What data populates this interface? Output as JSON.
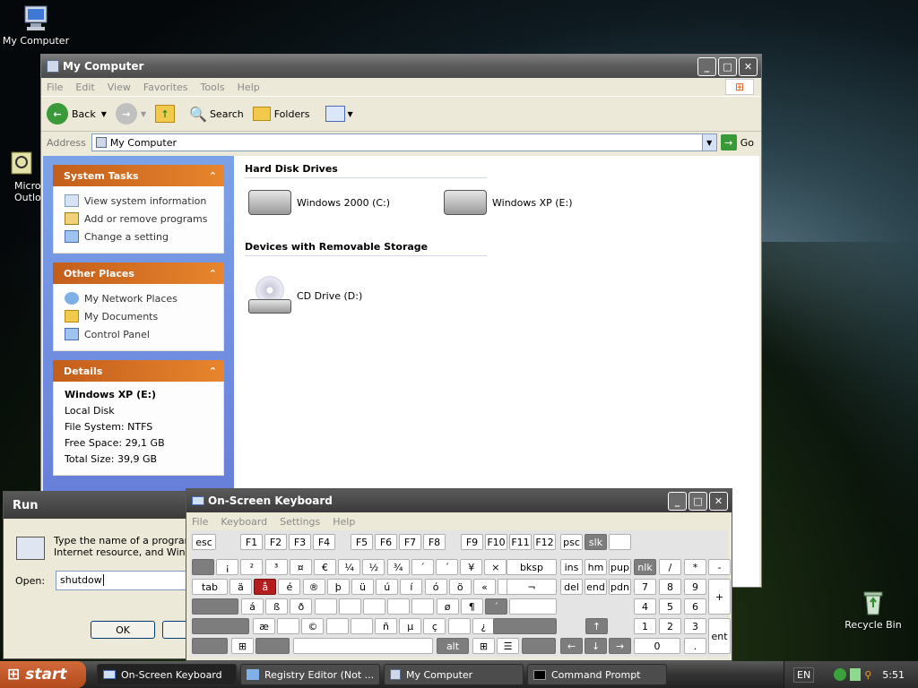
{
  "desktop": {
    "icons": {
      "my_computer": "My Computer",
      "outlook": "Micros\nOutlo",
      "recycle_bin": "Recycle Bin"
    }
  },
  "explorer": {
    "title": "My Computer",
    "menu": [
      "File",
      "Edit",
      "View",
      "Favorites",
      "Tools",
      "Help"
    ],
    "toolbar": {
      "back": "Back",
      "search": "Search",
      "folders": "Folders"
    },
    "address": {
      "label": "Address",
      "value": "My Computer",
      "go": "Go"
    },
    "system_tasks": {
      "title": "System Tasks",
      "items": [
        "View system information",
        "Add or remove programs",
        "Change a setting"
      ]
    },
    "other_places": {
      "title": "Other Places",
      "items": [
        "My Network Places",
        "My Documents",
        "Control Panel"
      ]
    },
    "details": {
      "title": "Details",
      "name": "Windows XP (E:)",
      "type": "Local Disk",
      "fs": "File System: NTFS",
      "free": "Free Space: 29,1 GB",
      "total": "Total Size: 39,9 GB"
    },
    "sections": {
      "hdd": "Hard Disk Drives",
      "removable": "Devices with Removable Storage"
    },
    "drives": {
      "c": "Windows 2000 (C:)",
      "e": "Windows XP (E:)",
      "d": "CD Drive (D:)"
    }
  },
  "run": {
    "title": "Run",
    "desc1": "Type the name of a program, f",
    "desc2": "Internet resource, and Windov",
    "open_label": "Open:",
    "open_value": "shutdow",
    "ok": "OK"
  },
  "osk": {
    "title": "On-Screen Keyboard",
    "menu": [
      "File",
      "Keyboard",
      "Settings",
      "Help"
    ],
    "row1": [
      "esc",
      "F1",
      "F2",
      "F3",
      "F4",
      "F5",
      "F6",
      "F7",
      "F8",
      "F9",
      "F10",
      "F11",
      "F12",
      "psc",
      "slk",
      ""
    ],
    "row2": [
      "",
      "¡",
      "²",
      "³",
      "¤",
      "€",
      "¼",
      "½",
      "¾",
      "´",
      "´",
      "¥",
      "×",
      "bksp",
      "ins",
      "hm",
      "pup",
      "nlk",
      "/",
      "*",
      "-"
    ],
    "row3": [
      "tab",
      "ä",
      "å",
      "é",
      "®",
      "þ",
      "ü",
      "ú",
      "í",
      "ó",
      "ö",
      "«",
      "»",
      "¬",
      "del",
      "end",
      "pdn",
      "7",
      "8",
      "9",
      "+"
    ],
    "row4": [
      "",
      "á",
      "ß",
      "ð",
      "",
      "",
      "",
      "",
      "",
      "ø",
      "¶",
      "´",
      "",
      "4",
      "5",
      "6"
    ],
    "row5": [
      "",
      "æ",
      "",
      "©",
      "",
      "",
      "ñ",
      "µ",
      "ç",
      "",
      "¿",
      "",
      "1",
      "2",
      "3",
      "ent"
    ],
    "row6": [
      "",
      "",
      "",
      "",
      "alt",
      "",
      "",
      "",
      "0",
      "."
    ]
  },
  "taskbar": {
    "start": "start",
    "tasks": [
      "On-Screen Keyboard",
      "Registry Editor (Not ...",
      "My Computer",
      "Command Prompt"
    ],
    "lang": "EN",
    "time": "5:51"
  }
}
